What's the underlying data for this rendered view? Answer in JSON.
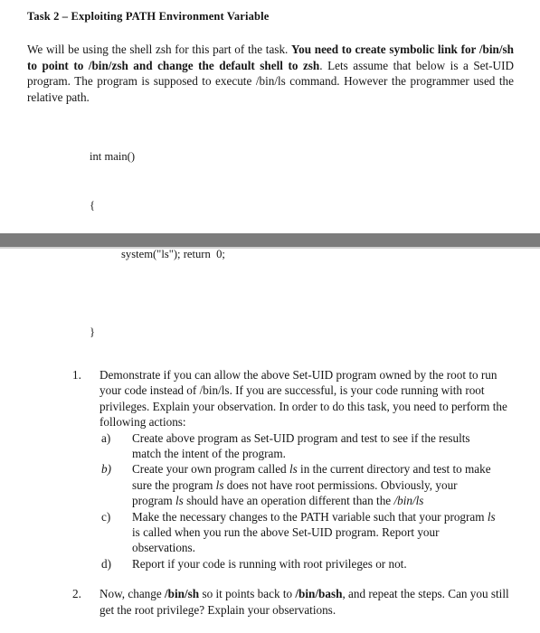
{
  "document": {
    "title": "Task 2 – Exploiting PATH Environment Variable",
    "intro": {
      "seg1": "We will be using the shell zsh for this part of the task. ",
      "seg2_bold": "You need to create symbolic link for /bin/sh to point to /bin/zsh and change the default shell to zsh",
      "seg3": ". Lets assume that below is a Set-UID program. The program is supposed to execute /bin/ls command. However the programmer used the relative path."
    },
    "code": {
      "line1": "int main()",
      "line2": "{",
      "line3": "system(\"ls\"); return  0;",
      "line_close": "}"
    },
    "divider": {
      "band_color": "#7c7c7c",
      "shadow_color": "#d3d3d3"
    },
    "list": {
      "items": [
        {
          "marker": "1.",
          "text": "Demonstrate if you can allow the above Set-UID program owned by the root to run your code instead of /bin/ls. If you are successful, is your code running with root privileges. Explain your observation. In order to do this task, you need to perform the following actions:",
          "subitems": [
            {
              "marker": "a)",
              "marker_italic": false,
              "parts": [
                {
                  "t": "Create above program as Set-UID program and test to see if the results match the intent of the program.",
                  "style": "normal"
                }
              ]
            },
            {
              "marker": "b)",
              "marker_italic": true,
              "parts": [
                {
                  "t": "Create your own program called ",
                  "style": "normal"
                },
                {
                  "t": "ls",
                  "style": "italic"
                },
                {
                  "t": " in the current directory and test to make sure the program ",
                  "style": "normal"
                },
                {
                  "t": "ls",
                  "style": "italic"
                },
                {
                  "t": " does not have root permissions. Obviously, your program ",
                  "style": "normal"
                },
                {
                  "t": "ls",
                  "style": "italic"
                },
                {
                  "t": " should have an operation different than the ",
                  "style": "normal"
                },
                {
                  "t": "/bin/ls",
                  "style": "italic"
                }
              ]
            },
            {
              "marker": "c)",
              "marker_italic": false,
              "parts": [
                {
                  "t": "Make the necessary changes to the PATH variable such that your program ",
                  "style": "normal"
                },
                {
                  "t": "ls",
                  "style": "italic"
                },
                {
                  "t": " is called when you run the above Set-UID program. Report your observations.",
                  "style": "normal"
                }
              ]
            },
            {
              "marker": "d)",
              "marker_italic": false,
              "parts": [
                {
                  "t": "Report if your code is running with root privileges or not.",
                  "style": "normal"
                }
              ]
            }
          ]
        },
        {
          "marker": "2.",
          "parts": [
            {
              "t": "Now, change ",
              "style": "normal"
            },
            {
              "t": "/bin/sh",
              "style": "bold"
            },
            {
              "t": " so it points back to ",
              "style": "normal"
            },
            {
              "t": "/bin/bash",
              "style": "bold"
            },
            {
              "t": ", and repeat the steps. Can you still get the root privilege? Explain your observations.",
              "style": "normal"
            }
          ],
          "subitems": []
        }
      ]
    }
  }
}
